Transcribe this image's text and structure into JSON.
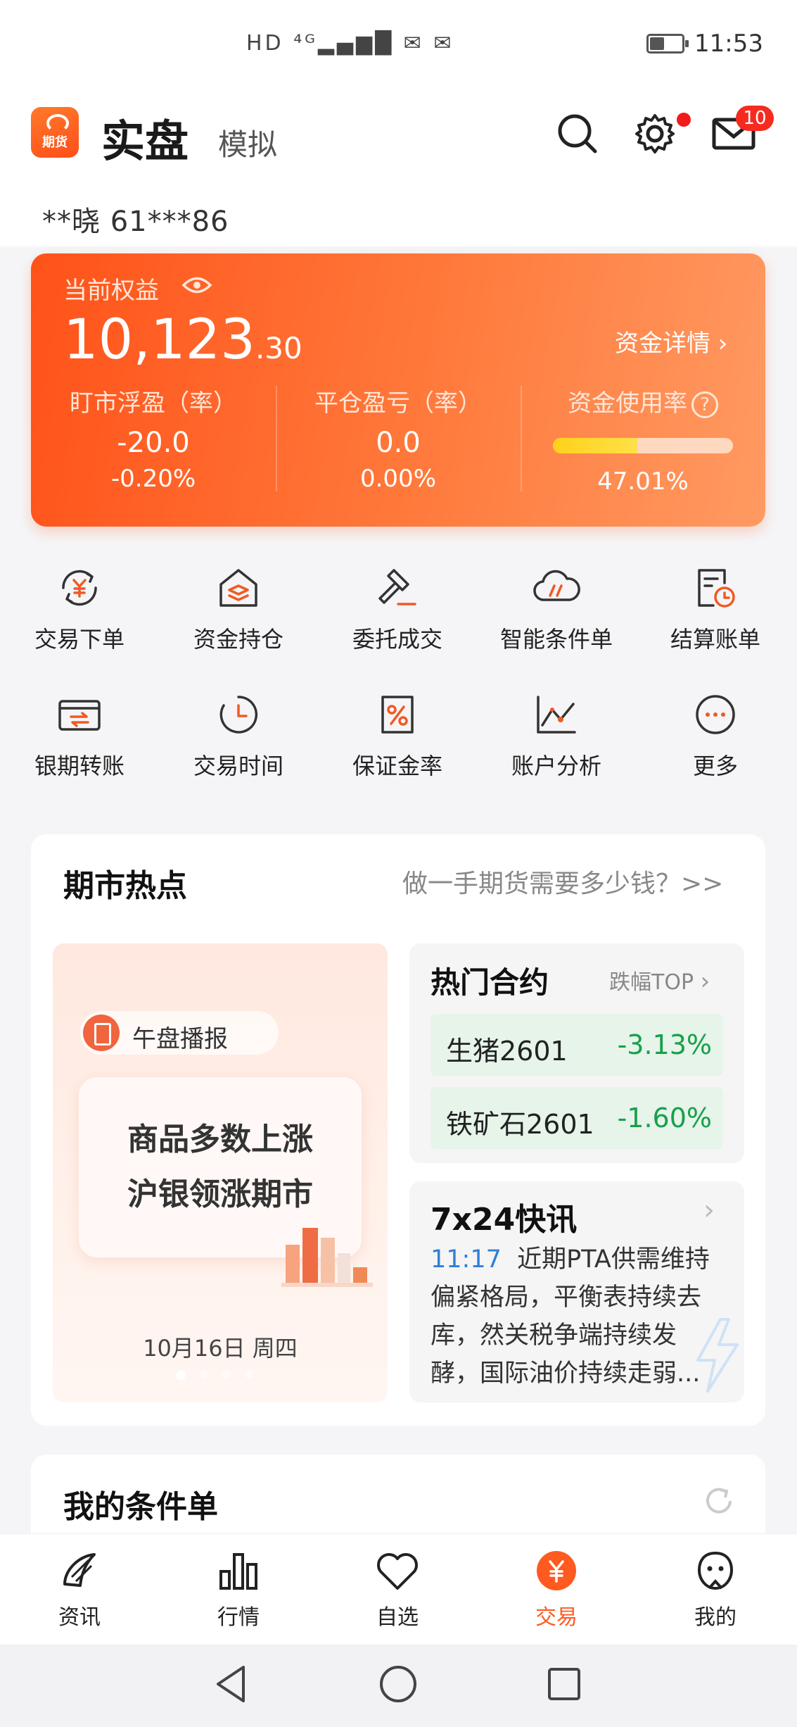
{
  "status": {
    "icons": "HD ⁴ᴳ▂▄▆█ ✉ ✉",
    "time": "11:53"
  },
  "header": {
    "logo_text": "期货",
    "tab_real": "实盘",
    "tab_sim": "模拟",
    "mail_badge": "10"
  },
  "account": {
    "label": "**晓  61***86"
  },
  "equity": {
    "label": "当前权益",
    "value_int": "10,123",
    "value_dec": ".30",
    "detail_link": "资金详情 ›",
    "col1": {
      "label": "盯市浮盈（率）",
      "value": "-20.0",
      "rate": "-0.20%"
    },
    "col2": {
      "label": "平仓盈亏（率）",
      "value": "0.0",
      "rate": "0.00%"
    },
    "col3": {
      "label": "资金使用率",
      "help": "?",
      "rate": "47.01%",
      "progress": 0.4701
    }
  },
  "grid": [
    {
      "label": "交易下单",
      "icon": "yuan-cycle-icon"
    },
    {
      "label": "资金持仓",
      "icon": "house-layers-icon"
    },
    {
      "label": "委托成交",
      "icon": "gavel-icon"
    },
    {
      "label": "智能条件单",
      "icon": "cloud-icon"
    },
    {
      "label": "结算账单",
      "icon": "bill-clock-icon"
    },
    {
      "label": "银期转账",
      "icon": "card-transfer-icon"
    },
    {
      "label": "交易时间",
      "icon": "clock-icon"
    },
    {
      "label": "保证金率",
      "icon": "percent-icon"
    },
    {
      "label": "账户分析",
      "icon": "line-chart-icon"
    },
    {
      "label": "更多",
      "icon": "more-icon"
    }
  ],
  "hot": {
    "title": "期市热点",
    "link": "做一手期货需要多少钱？>>",
    "promo": {
      "chip": "午盘播报",
      "line1": "商品多数上涨",
      "line2": "沪银领涨期市",
      "date": "10月16日 周四"
    },
    "contracts": {
      "title": "热门合约",
      "link": "跌幅TOP",
      "rows": [
        {
          "name": "生猪2601",
          "value": "-3.13%"
        },
        {
          "name": "铁矿石2601",
          "value": "-1.60%"
        }
      ]
    },
    "news": {
      "title": "7x24快讯",
      "time": "11:17",
      "text": "近期PTA供需维持偏紧格局，平衡表持续去库，然关税争端持续发酵，国际油价持续走弱..."
    }
  },
  "conditions": {
    "title": "我的条件单"
  },
  "nav": [
    {
      "label": "资讯",
      "icon": "news-icon"
    },
    {
      "label": "行情",
      "icon": "bar-chart-icon"
    },
    {
      "label": "自选",
      "icon": "heart-icon"
    },
    {
      "label": "交易",
      "icon": "trade-yuan-icon"
    },
    {
      "label": "我的",
      "icon": "profile-icon"
    }
  ],
  "colors": {
    "accent": "#ff5a1f",
    "down": "#18a04a",
    "link": "#2f7fd8"
  }
}
